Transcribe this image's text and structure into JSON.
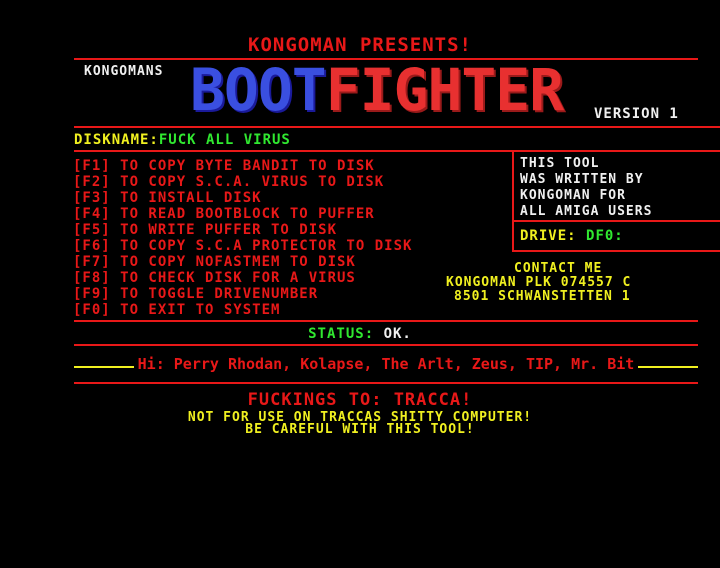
{
  "header": {
    "presents": "KONGOMAN PRESENTS!",
    "byline": "KONGOMANS",
    "logo_part1": "BOOT",
    "logo_part2": "FIGHTER",
    "version": "VERSION 1"
  },
  "diskname": {
    "label": "DISKNAME:",
    "value": "FUCK ALL VIRUS"
  },
  "menu": [
    "[F1] TO COPY BYTE BANDIT TO DISK",
    "[F2] TO COPY S.C.A. VIRUS TO DISK",
    "[F3] TO INSTALL DISK",
    "[F4] TO READ BOOTBLOCK TO PUFFER",
    "[F5] TO WRITE PUFFER TO DISK",
    "[F6] TO COPY S.C.A PROTECTOR TO DISK",
    "[F7] TO COPY NOFASTMEM TO DISK",
    "[F8] TO CHECK DISK FOR A VIRUS",
    "[F9] TO TOGGLE DRIVENUMBER",
    "[F0] TO EXIT TO SYSTEM"
  ],
  "info": {
    "tool_text": "THIS TOOL\nWAS WRITTEN BY\nKONGOMAN FOR\nALL AMIGA USERS",
    "drive_label": "DRIVE:",
    "drive_value": "DF0:"
  },
  "contact": {
    "title": "CONTACT ME",
    "line1": "KONGOMAN PLK 074557 C",
    "line2": "8501 SCHWANSTETTEN 1"
  },
  "status": {
    "label": "STATUS:",
    "value": "OK."
  },
  "greets": "Hi: Perry Rhodan, Kolapse, The Arlt, Zeus, TIP, Mr. Bit",
  "footer": {
    "fuck": "FUCKINGS TO: TRACCA!",
    "notfor": "NOT FOR USE ON TRACCAS SHITTY COMPUTER!",
    "careful": "BE CAREFUL WITH THIS TOOL!"
  },
  "colors": {
    "background": "#000000",
    "red": "#e81818",
    "green": "#30e830",
    "yellow": "#f0f020",
    "blue": "#3a4fe0"
  }
}
